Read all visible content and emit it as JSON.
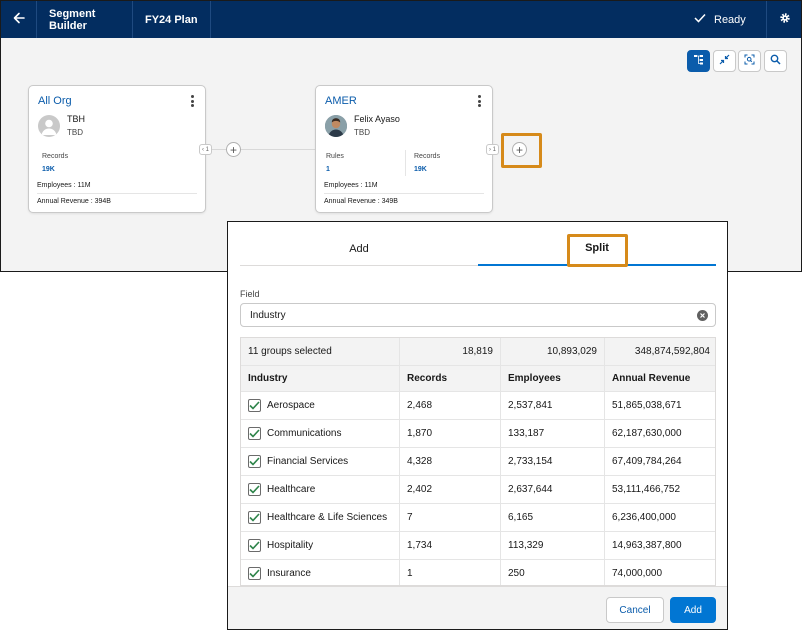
{
  "header": {
    "app_name": "Segment Builder",
    "plan_name": "FY24 Plan",
    "status": "Ready",
    "brand_color": "#032d60",
    "accent_color": "#0176d3"
  },
  "cards": {
    "all_org": {
      "title": "All Org",
      "person_name": "TBH",
      "person_title": "TBD",
      "records_label": "Records",
      "records_value": "19K",
      "employees": "Employees : 11M",
      "revenue": "Annual Revenue : 394B"
    },
    "amer": {
      "title": "AMER",
      "person_name": "Felix Ayaso",
      "person_title": "TBD",
      "rules_label": "Rules",
      "rules_value": "1",
      "records_label": "Records",
      "records_value": "19K",
      "employees": "Employees : 11M",
      "revenue": "Annual Revenue : 349B"
    },
    "collapse_label_1": "‹ 1",
    "collapse_label_2": "› 1"
  },
  "panel": {
    "tabs": {
      "add": "Add",
      "split": "Split"
    },
    "field_label": "Field",
    "field_value": "Industry",
    "summary": {
      "selected": "11 groups selected",
      "records": "18,819",
      "employees": "10,893,029",
      "revenue": "348,874,592,804"
    },
    "columns": [
      "Industry",
      "Records",
      "Employees",
      "Annual Revenue"
    ],
    "rows": [
      {
        "industry": "Aerospace",
        "records": "2,468",
        "employees": "2,537,841",
        "revenue": "51,865,038,671",
        "checked": true
      },
      {
        "industry": "Communications",
        "records": "1,870",
        "employees": "133,187",
        "revenue": "62,187,630,000",
        "checked": true
      },
      {
        "industry": "Financial Services",
        "records": "4,328",
        "employees": "2,733,154",
        "revenue": "67,409,784,264",
        "checked": true
      },
      {
        "industry": "Healthcare",
        "records": "2,402",
        "employees": "2,637,644",
        "revenue": "53,111,466,752",
        "checked": true
      },
      {
        "industry": "Healthcare & Life Sciences",
        "records": "7",
        "employees": "6,165",
        "revenue": "6,236,400,000",
        "checked": true
      },
      {
        "industry": "Hospitality",
        "records": "1,734",
        "employees": "113,329",
        "revenue": "14,963,387,800",
        "checked": true
      },
      {
        "industry": "Insurance",
        "records": "1",
        "employees": "250",
        "revenue": "74,000,000",
        "checked": true
      }
    ],
    "cancel_label": "Cancel",
    "add_label": "Add"
  }
}
